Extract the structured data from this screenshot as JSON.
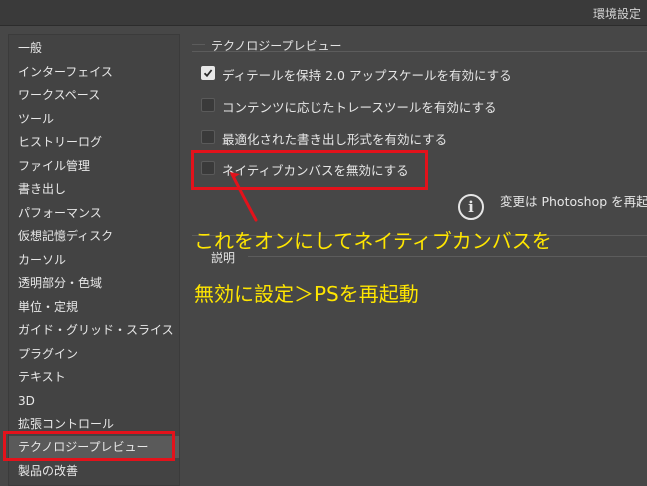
{
  "window": {
    "title": "環境設定"
  },
  "sidebar": {
    "items": [
      {
        "label": "一般"
      },
      {
        "label": "インターフェイス"
      },
      {
        "label": "ワークスペース"
      },
      {
        "label": "ツール"
      },
      {
        "label": "ヒストリーログ"
      },
      {
        "label": "ファイル管理"
      },
      {
        "label": "書き出し"
      },
      {
        "label": "パフォーマンス"
      },
      {
        "label": "仮想記憶ディスク"
      },
      {
        "label": "カーソル"
      },
      {
        "label": "透明部分・色域"
      },
      {
        "label": "単位・定規"
      },
      {
        "label": "ガイド・グリッド・スライス"
      },
      {
        "label": "プラグイン"
      },
      {
        "label": "テキスト"
      },
      {
        "label": "3D"
      },
      {
        "label": "拡張コントロール"
      },
      {
        "label": "テクノロジープレビュー"
      },
      {
        "label": "製品の改善"
      }
    ],
    "selected_index": 17
  },
  "main": {
    "group_title": "テクノロジープレビュー",
    "options": [
      {
        "label": "ディテールを保持 2.0 アップスケールを有効にする",
        "checked": true
      },
      {
        "label": "コンテンツに応じたトレースツールを有効にする",
        "checked": false
      },
      {
        "label": "最適化された書き出し形式を有効にする",
        "checked": false
      },
      {
        "label": "ネイティブカンバスを無効にする",
        "checked": false
      }
    ],
    "notice": "変更は Photoshop を再起",
    "description_title": "説明"
  },
  "annotation": {
    "line1": "これをオンにしてネイティブカンバスを",
    "line2": "無効に設定＞PSを再起動",
    "color": "#ffe600",
    "highlight_color": "#e3121b"
  }
}
